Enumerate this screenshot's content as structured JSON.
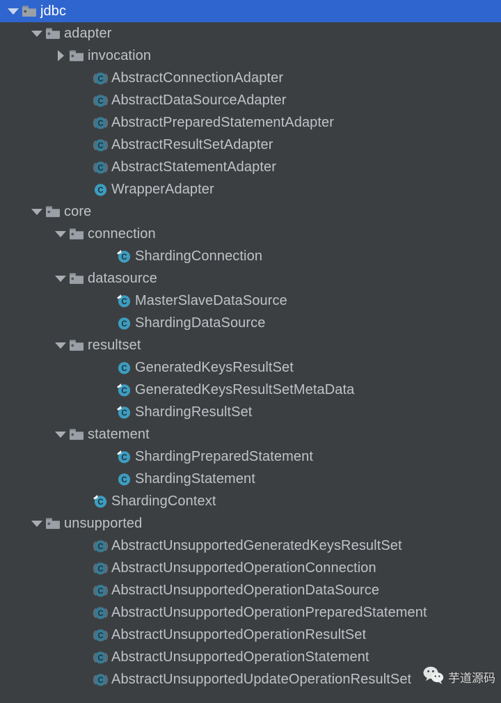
{
  "theme": {
    "background": "#3c3f41",
    "selection": "#2f65ce",
    "text": "#bfc3c7",
    "selected_text": "#ffffff",
    "folder_icon": "#9aa0a6",
    "class_icon": "#3d9dc0",
    "arrow": "#a9adb2"
  },
  "tree": {
    "rows": [
      {
        "label": "jdbc",
        "depth": 0,
        "icon": "folder-icon",
        "twisty": "expanded",
        "selected": true
      },
      {
        "label": "adapter",
        "depth": 1,
        "icon": "folder-icon",
        "twisty": "expanded",
        "selected": false
      },
      {
        "label": "invocation",
        "depth": 2,
        "icon": "folder-icon",
        "twisty": "collapsed",
        "selected": false
      },
      {
        "label": "AbstractConnectionAdapter",
        "depth": 3,
        "icon": "abstract-class-icon",
        "twisty": "none",
        "selected": false
      },
      {
        "label": "AbstractDataSourceAdapter",
        "depth": 3,
        "icon": "abstract-class-icon",
        "twisty": "none",
        "selected": false
      },
      {
        "label": "AbstractPreparedStatementAdapter",
        "depth": 3,
        "icon": "abstract-class-icon",
        "twisty": "none",
        "selected": false
      },
      {
        "label": "AbstractResultSetAdapter",
        "depth": 3,
        "icon": "abstract-class-icon",
        "twisty": "none",
        "selected": false
      },
      {
        "label": "AbstractStatementAdapter",
        "depth": 3,
        "icon": "abstract-class-icon",
        "twisty": "none",
        "selected": false
      },
      {
        "label": "WrapperAdapter",
        "depth": 3,
        "icon": "class-icon",
        "twisty": "none",
        "selected": false
      },
      {
        "label": "core",
        "depth": 1,
        "icon": "folder-icon",
        "twisty": "expanded",
        "selected": false
      },
      {
        "label": "connection",
        "depth": 2,
        "icon": "folder-icon",
        "twisty": "expanded",
        "selected": false
      },
      {
        "label": "ShardingConnection",
        "depth": 4,
        "icon": "class-override-icon",
        "twisty": "none",
        "selected": false
      },
      {
        "label": "datasource",
        "depth": 2,
        "icon": "folder-icon",
        "twisty": "expanded",
        "selected": false
      },
      {
        "label": "MasterSlaveDataSource",
        "depth": 4,
        "icon": "class-override-icon",
        "twisty": "none",
        "selected": false
      },
      {
        "label": "ShardingDataSource",
        "depth": 4,
        "icon": "class-icon",
        "twisty": "none",
        "selected": false
      },
      {
        "label": "resultset",
        "depth": 2,
        "icon": "folder-icon",
        "twisty": "expanded",
        "selected": false
      },
      {
        "label": "GeneratedKeysResultSet",
        "depth": 4,
        "icon": "class-icon",
        "twisty": "none",
        "selected": false
      },
      {
        "label": "GeneratedKeysResultSetMetaData",
        "depth": 4,
        "icon": "class-override-icon",
        "twisty": "none",
        "selected": false
      },
      {
        "label": "ShardingResultSet",
        "depth": 4,
        "icon": "class-override-icon",
        "twisty": "none",
        "selected": false
      },
      {
        "label": "statement",
        "depth": 2,
        "icon": "folder-icon",
        "twisty": "expanded",
        "selected": false
      },
      {
        "label": "ShardingPreparedStatement",
        "depth": 4,
        "icon": "class-override-icon",
        "twisty": "none",
        "selected": false
      },
      {
        "label": "ShardingStatement",
        "depth": 4,
        "icon": "class-icon",
        "twisty": "none",
        "selected": false
      },
      {
        "label": "ShardingContext",
        "depth": 3,
        "icon": "class-override-icon",
        "twisty": "none",
        "selected": false
      },
      {
        "label": "unsupported",
        "depth": 1,
        "icon": "folder-icon",
        "twisty": "expanded",
        "selected": false
      },
      {
        "label": "AbstractUnsupportedGeneratedKeysResultSet",
        "depth": 3,
        "icon": "abstract-class-icon",
        "twisty": "none",
        "selected": false
      },
      {
        "label": "AbstractUnsupportedOperationConnection",
        "depth": 3,
        "icon": "abstract-class-icon",
        "twisty": "none",
        "selected": false
      },
      {
        "label": "AbstractUnsupportedOperationDataSource",
        "depth": 3,
        "icon": "abstract-class-icon",
        "twisty": "none",
        "selected": false
      },
      {
        "label": "AbstractUnsupportedOperationPreparedStatement",
        "depth": 3,
        "icon": "abstract-class-icon",
        "twisty": "none",
        "selected": false
      },
      {
        "label": "AbstractUnsupportedOperationResultSet",
        "depth": 3,
        "icon": "abstract-class-icon",
        "twisty": "none",
        "selected": false
      },
      {
        "label": "AbstractUnsupportedOperationStatement",
        "depth": 3,
        "icon": "abstract-class-icon",
        "twisty": "none",
        "selected": false
      },
      {
        "label": "AbstractUnsupportedUpdateOperationResultSet",
        "depth": 3,
        "icon": "abstract-class-icon",
        "twisty": "none",
        "selected": false
      }
    ]
  },
  "watermark": {
    "icon": "wechat-icon",
    "text": "芋道源码"
  }
}
